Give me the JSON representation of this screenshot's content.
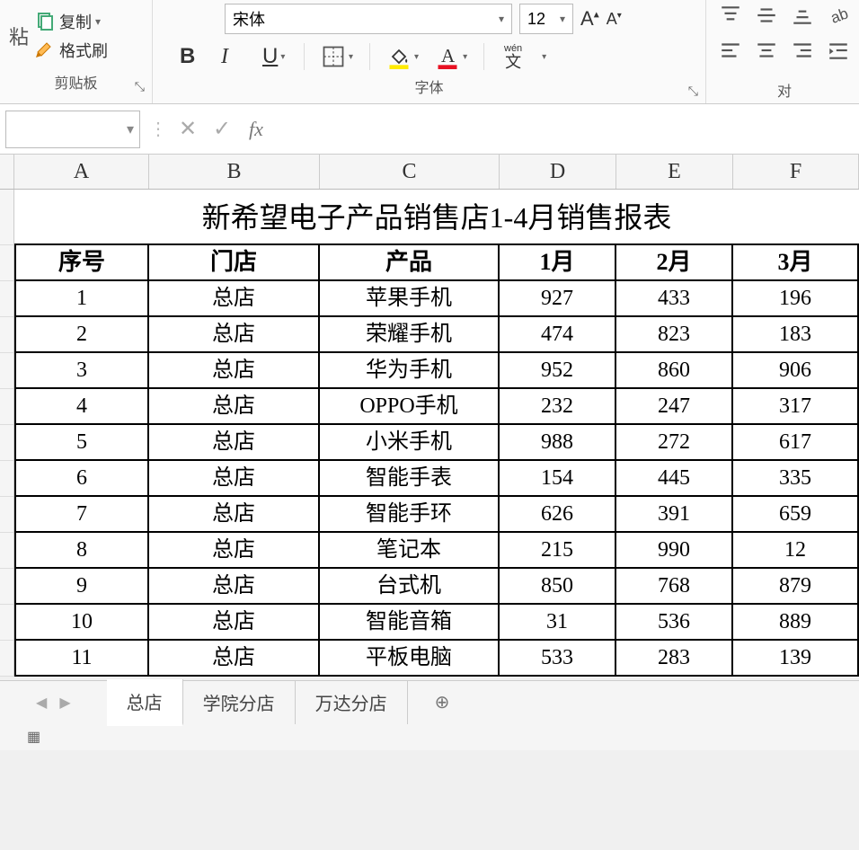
{
  "ribbon": {
    "paste_arrow": "粘",
    "copy": "复制",
    "format_painter": "格式刷",
    "clipboard_label": "剪贴板",
    "font_name": "宋体",
    "font_size": "12",
    "bold": "B",
    "italic": "I",
    "ruby": "wén",
    "ruby_sub": "文",
    "font_label": "字体",
    "align_label": "对"
  },
  "formula_bar": {
    "name_box": "",
    "cancel": "✕",
    "enter": "✓",
    "fx": "fx",
    "formula": ""
  },
  "columns": [
    "A",
    "B",
    "C",
    "D",
    "E",
    "F"
  ],
  "title": "新希望电子产品销售店1-4月销售报表",
  "headers": [
    "序号",
    "门店",
    "产品",
    "1月",
    "2月",
    "3月"
  ],
  "rows": [
    [
      "1",
      "总店",
      "苹果手机",
      "927",
      "433",
      "196"
    ],
    [
      "2",
      "总店",
      "荣耀手机",
      "474",
      "823",
      "183"
    ],
    [
      "3",
      "总店",
      "华为手机",
      "952",
      "860",
      "906"
    ],
    [
      "4",
      "总店",
      "OPPO手机",
      "232",
      "247",
      "317"
    ],
    [
      "5",
      "总店",
      "小米手机",
      "988",
      "272",
      "617"
    ],
    [
      "6",
      "总店",
      "智能手表",
      "154",
      "445",
      "335"
    ],
    [
      "7",
      "总店",
      "智能手环",
      "626",
      "391",
      "659"
    ],
    [
      "8",
      "总店",
      "笔记本",
      "215",
      "990",
      "12"
    ],
    [
      "9",
      "总店",
      "台式机",
      "850",
      "768",
      "879"
    ],
    [
      "10",
      "总店",
      "智能音箱",
      "31",
      "536",
      "889"
    ],
    [
      "11",
      "总店",
      "平板电脑",
      "533",
      "283",
      "139"
    ]
  ],
  "tabs": {
    "active": "总店",
    "others": [
      "学院分店",
      "万达分店"
    ]
  }
}
